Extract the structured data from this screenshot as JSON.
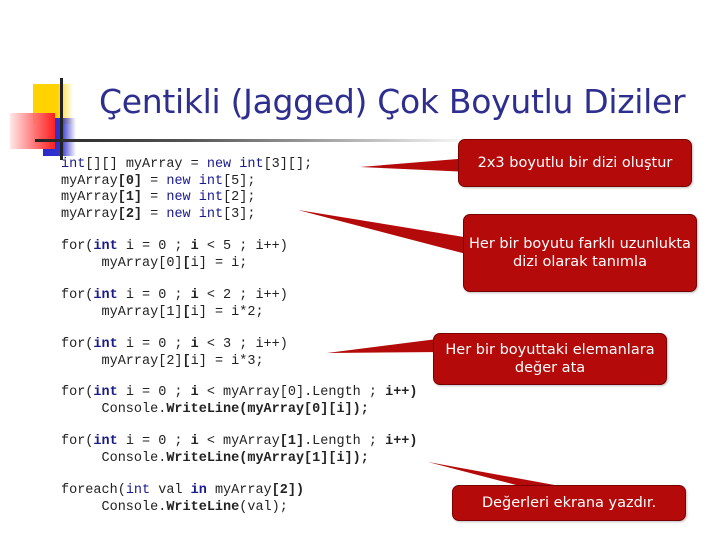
{
  "slide": {
    "title": "Çentikli (Jagged) Çok Boyutlu Diziler",
    "colors": {
      "title": "#2e2e8f",
      "callout_fill": "#b50a0a",
      "callout_text": "#ffffff",
      "code_keyword": "#1a1a8c",
      "code_text": "#222222"
    }
  },
  "code_blocks": [
    {
      "name": "declaration",
      "lines": [
        [
          {
            "t": "int",
            "k": 1
          },
          {
            "t": "[][] myArray = "
          },
          {
            "t": "new int",
            "k": 1
          },
          {
            "t": "[3][];"
          }
        ],
        [
          {
            "t": "myArray"
          },
          {
            "t": "[0]",
            "b": 1
          },
          {
            "t": " = "
          },
          {
            "t": "new int",
            "k": 1
          },
          {
            "t": "[5];"
          }
        ],
        [
          {
            "t": "myArray"
          },
          {
            "t": "[1]",
            "b": 1
          },
          {
            "t": " = "
          },
          {
            "t": "new int",
            "k": 1
          },
          {
            "t": "[2];"
          }
        ],
        [
          {
            "t": "myArray"
          },
          {
            "t": "[2]",
            "b": 1
          },
          {
            "t": " = "
          },
          {
            "t": "new int",
            "k": 1
          },
          {
            "t": "[3];"
          }
        ]
      ]
    },
    {
      "name": "loop-0",
      "lines": [
        [
          {
            "t": "for("
          },
          {
            "t": "int",
            "k": 1,
            "b": 1
          },
          {
            "t": " i = 0 ; "
          },
          {
            "t": "i",
            "b": 1
          },
          {
            "t": " < 5 ; i++)"
          }
        ],
        [
          {
            "t": "     myArray[0]"
          },
          {
            "t": "[",
            "b": 1
          },
          {
            "t": "i] = i;"
          }
        ]
      ]
    },
    {
      "name": "loop-1",
      "lines": [
        [
          {
            "t": "for("
          },
          {
            "t": "int",
            "k": 1,
            "b": 1
          },
          {
            "t": " i = 0 ; "
          },
          {
            "t": "i",
            "b": 1
          },
          {
            "t": " < 2 ; i++)"
          }
        ],
        [
          {
            "t": "     myArray[1]"
          },
          {
            "t": "[",
            "b": 1
          },
          {
            "t": "i] = i*2;"
          }
        ]
      ]
    },
    {
      "name": "loop-2",
      "lines": [
        [
          {
            "t": "for("
          },
          {
            "t": "int",
            "k": 1,
            "b": 1
          },
          {
            "t": " i = 0 ; "
          },
          {
            "t": "i",
            "b": 1
          },
          {
            "t": " < 3 ; i++)"
          }
        ],
        [
          {
            "t": "     myArray[2]"
          },
          {
            "t": "[",
            "b": 1
          },
          {
            "t": "i] = i*3;"
          }
        ]
      ]
    },
    {
      "name": "print-loop-0",
      "lines": [
        [
          {
            "t": "for("
          },
          {
            "t": "int",
            "k": 1,
            "b": 1
          },
          {
            "t": " i = 0 ; "
          },
          {
            "t": "i",
            "b": 1
          },
          {
            "t": " < myArray[0].Length ; "
          },
          {
            "t": "i++)",
            "b": 1
          }
        ],
        [
          {
            "t": "     Console."
          },
          {
            "t": "WriteLine(myArray[0][i]);",
            "b": 1
          }
        ]
      ]
    },
    {
      "name": "print-loop-1",
      "lines": [
        [
          {
            "t": "for("
          },
          {
            "t": "int",
            "k": 1,
            "b": 1
          },
          {
            "t": " i = 0 ; "
          },
          {
            "t": "i",
            "b": 1
          },
          {
            "t": " < myArray"
          },
          {
            "t": "[1]",
            "b": 1
          },
          {
            "t": ".Length ; "
          },
          {
            "t": "i++)",
            "b": 1
          }
        ],
        [
          {
            "t": "     Console."
          },
          {
            "t": "WriteLine(myArray[1][i]);",
            "b": 1
          }
        ]
      ]
    },
    {
      "name": "foreach-loop",
      "lines": [
        [
          {
            "t": "foreach("
          },
          {
            "t": "int",
            "k": 1
          },
          {
            "t": " val "
          },
          {
            "t": "in",
            "k": 1,
            "b": 1
          },
          {
            "t": " myArray"
          },
          {
            "t": "[2])",
            "b": 1
          }
        ],
        [
          {
            "t": "     Console."
          },
          {
            "t": "WriteLine",
            "b": 1
          },
          {
            "t": "(val);"
          }
        ]
      ]
    }
  ],
  "callouts": [
    {
      "text": "2x3 boyutlu bir dizi oluştur"
    },
    {
      "text": "Her bir boyutu farklı uzunlukta dizi olarak tanımla"
    },
    {
      "text": "Her bir boyuttaki elemanlara değer ata"
    },
    {
      "text": "Değerleri ekrana yazdır."
    }
  ]
}
